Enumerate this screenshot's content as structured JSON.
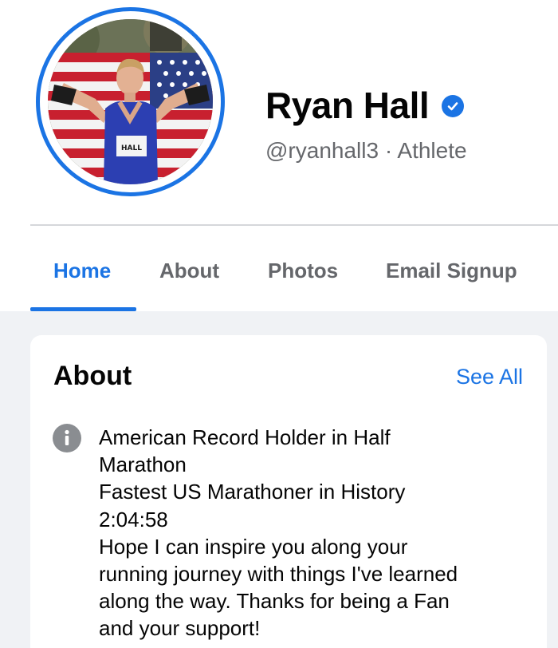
{
  "profile": {
    "name": "Ryan Hall",
    "handle_and_category": "@ryanhall3 · Athlete",
    "verified": true,
    "avatar_bib_text": "HALL"
  },
  "tabs": [
    {
      "label": "Home",
      "active": true
    },
    {
      "label": "About",
      "active": false
    },
    {
      "label": "Photos",
      "active": false
    },
    {
      "label": "Email Signup",
      "active": false
    }
  ],
  "about": {
    "title": "About",
    "see_all_label": "See All",
    "icon": "info-icon",
    "lines": [
      "American Record Holder in Half",
      "Marathon",
      "Fastest US Marathoner in History",
      "2:04:58",
      "Hope I can inspire you along your",
      "running journey with things I've learned",
      "along the way. Thanks for being a Fan",
      "and your support!"
    ]
  },
  "colors": {
    "accent": "#1b74e4",
    "text_primary": "#050505",
    "text_secondary": "#65676b",
    "page_background": "#f0f2f5"
  }
}
